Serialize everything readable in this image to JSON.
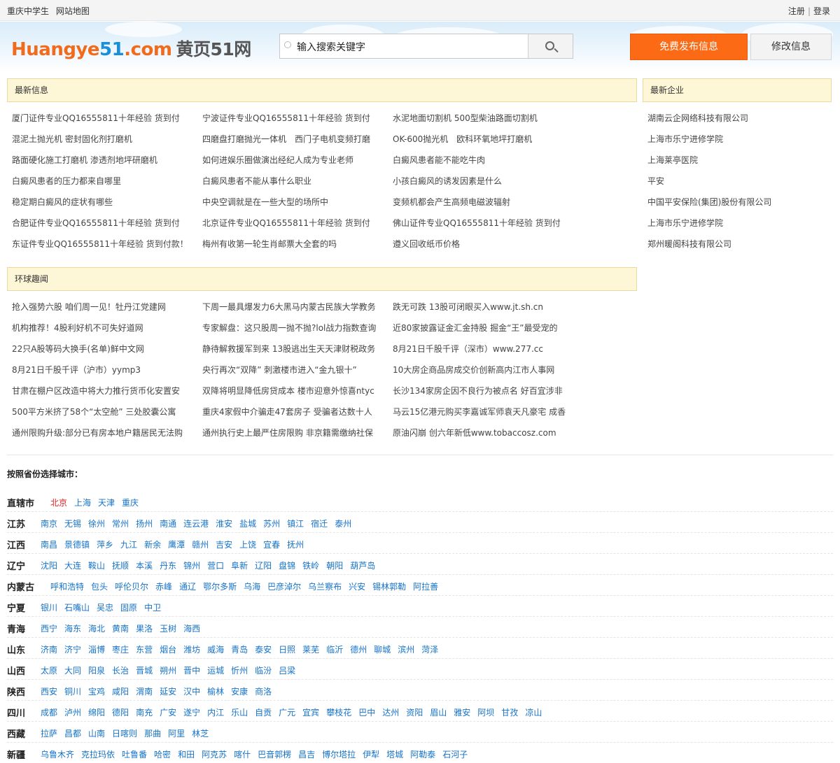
{
  "topbar": {
    "left": [
      "重庆中学生",
      "网站地图"
    ],
    "register": "注册",
    "sep": "|",
    "login": "登录"
  },
  "header": {
    "logo_orange1": "Huangye",
    "logo_blue": "51",
    "logo_orange2": ".com",
    "logo_cn": "黄页51网",
    "search_placeholder": "输入搜索关键字",
    "publish_button": "免费发布信息",
    "modify_button": "修改信息"
  },
  "latest_info": {
    "title": "最新信息",
    "columns": [
      [
        "厦门证件专业QQ16555811十年经验 货到付",
        "混泥土抛光机 密封固化剂打磨机",
        "路面硬化施工打磨机 渗透剂地坪研磨机",
        "白癜风患者的压力都来自哪里",
        "稳定期白癜风的症状有哪些",
        "合肥证件专业QQ16555811十年经验 货到付",
        "东证件专业QQ16555811十年经验 货到付款！"
      ],
      [
        "宁波证件专业QQ16555811十年经验 货到付",
        "四磨盘打磨抛光一体机　西门子电机变频打磨",
        "如何进娱乐圈做演出经纪人成为专业老师",
        "白癜风患者不能从事什么职业",
        "中央空调就是在一些大型的场所中",
        "北京证件专业QQ16555811十年经验 货到付",
        "梅州有收第一轮生肖邮票大全套的吗"
      ],
      [
        "水泥地面切割机 500型柴油路面切割机",
        "OK-600抛光机　欧科环氧地坪打磨机",
        "白癜风患者能不能吃牛肉",
        "小孩白癜风的诱发因素是什么",
        "变频机都会产生高频电磁波辐射",
        "佛山证件专业QQ16555811十年经验 货到付",
        "遵义回收纸币价格"
      ]
    ]
  },
  "latest_companies": {
    "title": "最新企业",
    "items": [
      "湖南云企网络科技有限公司",
      "上海市乐宁进修学院",
      "上海莱亭医院",
      "平安",
      "中国平安保险(集团)股份有限公司",
      "上海市乐宁进修学院",
      "郑州暖阁科技有限公司"
    ]
  },
  "global_news": {
    "title": "环球趣闻",
    "columns": [
      [
        "抢入强势六股 咱们周一见！牡丹江党建网",
        "机构推荐！4股利好机不可失好道网",
        "22只A股等码大换手(名单)鲜中文网",
        "8月21日千股千评（沪市）yymp3",
        "甘肃在棚户区改造中将大力推行货币化安置安",
        "500平方米挤了58个“太空舱” 三处胶囊公寓",
        "通州限购升级:部分已有房本地户籍居民无法购"
      ],
      [
        "下周一最具爆发力6大黑马内蒙古民族大学教务",
        "专家解盘：这只股周一抛不抛?lol战力指数查询",
        "静待解救援军到来 13股逃出生天天津财税政务",
        "央行再次“双降” 刺激楼市进入“金九银十”",
        "双降将明显降低房贷成本 楼市迎意外惊喜ntyc",
        "重庆4家假中介骗走47套房子 受骗者达数十人",
        "通州执行史上最严住房限购 非京籍需缴纳社保"
      ],
      [
        "跌无可跌 13股可闭眼买入www.jt.sh.cn",
        "近80家披露证金汇金持股 掘金“王”最受宠的",
        "8月21日千股千评（深市）www.277.cc",
        "10大房企商品房成交价创新高内江市人事网",
        "长沙134家房企因不良行为被点名 好百宜涉非",
        "马云15亿港元购买李嘉诚军师袁天凡豪宅 成香",
        "原油闪崩 创六年新低www.tobaccosz.com"
      ]
    ]
  },
  "provinces": {
    "title": "按照省份选择城市：",
    "rows": [
      {
        "name": "直辖市",
        "cities": [
          "北京",
          "上海",
          "天津",
          "重庆"
        ]
      },
      {
        "name": "江苏",
        "cities": [
          "南京",
          "无锡",
          "徐州",
          "常州",
          "扬州",
          "南通",
          "连云港",
          "淮安",
          "盐城",
          "苏州",
          "镇江",
          "宿迁",
          "泰州"
        ]
      },
      {
        "name": "江西",
        "cities": [
          "南昌",
          "景德镇",
          "萍乡",
          "九江",
          "新余",
          "鹰潭",
          "赣州",
          "吉安",
          "上饶",
          "宜春",
          "抚州"
        ]
      },
      {
        "name": "辽宁",
        "cities": [
          "沈阳",
          "大连",
          "鞍山",
          "抚顺",
          "本溪",
          "丹东",
          "锦州",
          "营口",
          "阜新",
          "辽阳",
          "盘锦",
          "铁岭",
          "朝阳",
          "葫芦岛"
        ]
      },
      {
        "name": "内蒙古",
        "cities": [
          "呼和浩特",
          "包头",
          "呼伦贝尔",
          "赤峰",
          "通辽",
          "鄂尔多斯",
          "乌海",
          "巴彦淖尔",
          "乌兰察布",
          "兴安",
          "锡林郭勒",
          "阿拉善"
        ]
      },
      {
        "name": "宁夏",
        "cities": [
          "银川",
          "石嘴山",
          "吴忠",
          "固原",
          "中卫"
        ]
      },
      {
        "name": "青海",
        "cities": [
          "西宁",
          "海东",
          "海北",
          "黄南",
          "果洛",
          "玉树",
          "海西"
        ]
      },
      {
        "name": "山东",
        "cities": [
          "济南",
          "济宁",
          "淄博",
          "枣庄",
          "东营",
          "烟台",
          "潍坊",
          "威海",
          "青岛",
          "泰安",
          "日照",
          "莱芜",
          "临沂",
          "德州",
          "聊城",
          "滨州",
          "菏泽"
        ]
      },
      {
        "name": "山西",
        "cities": [
          "太原",
          "大同",
          "阳泉",
          "长治",
          "晋城",
          "朔州",
          "晋中",
          "运城",
          "忻州",
          "临汾",
          "吕梁"
        ]
      },
      {
        "name": "陕西",
        "cities": [
          "西安",
          "铜川",
          "宝鸡",
          "咸阳",
          "渭南",
          "延安",
          "汉中",
          "榆林",
          "安康",
          "商洛"
        ]
      },
      {
        "name": "四川",
        "cities": [
          "成都",
          "泸州",
          "绵阳",
          "德阳",
          "南充",
          "广安",
          "遂宁",
          "内江",
          "乐山",
          "自贡",
          "广元",
          "宜宾",
          "攀枝花",
          "巴中",
          "达州",
          "资阳",
          "眉山",
          "雅安",
          "阿坝",
          "甘孜",
          "凉山"
        ]
      },
      {
        "name": "西藏",
        "cities": [
          "拉萨",
          "昌都",
          "山南",
          "日喀则",
          "那曲",
          "阿里",
          "林芝"
        ]
      },
      {
        "name": "新疆",
        "cities": [
          "乌鲁木齐",
          "克拉玛依",
          "吐鲁番",
          "哈密",
          "和田",
          "阿克苏",
          "喀什",
          "巴音郭楞",
          "昌吉",
          "博尔塔拉",
          "伊犁",
          "塔城",
          "阿勒泰",
          "石河子"
        ]
      }
    ]
  },
  "colors": {
    "accent": "#fd6a15",
    "link": "#1673c9",
    "hot": "#e02020",
    "panel_head": "#fdf6d7"
  }
}
